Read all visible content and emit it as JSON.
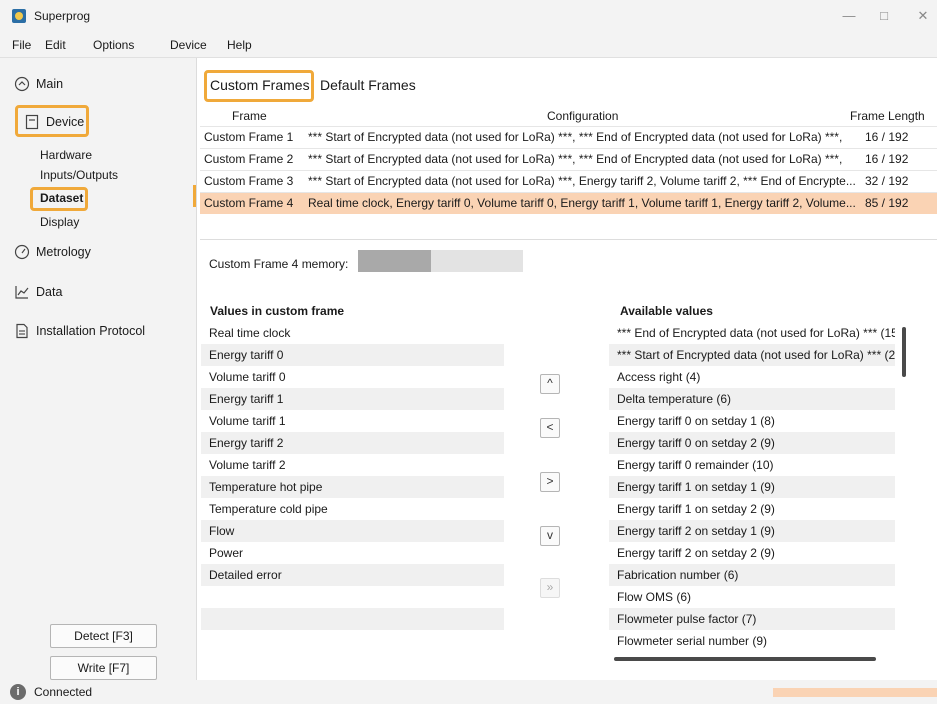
{
  "window": {
    "title": "Superprog",
    "minimize": "—",
    "maximize": "□",
    "close": "✕"
  },
  "menu": [
    "File",
    "Edit",
    "Options",
    "Device",
    "Help"
  ],
  "sidebar": {
    "main": "Main",
    "device": "Device",
    "device_items": [
      "Hardware",
      "Inputs/Outputs",
      "Dataset",
      "Display"
    ],
    "metrology": "Metrology",
    "data": "Data",
    "installation": "Installation Protocol",
    "detect_button": "Detect [F3]",
    "write_button": "Write [F7]"
  },
  "status": {
    "text": "Connected",
    "icon_glyph": "i"
  },
  "tabs": {
    "custom": "Custom Frames",
    "default": "Default Frames"
  },
  "frames_table": {
    "columns": [
      "Frame",
      "Configuration",
      "Frame Length"
    ],
    "rows": [
      {
        "frame": "Custom Frame 1",
        "config": "*** Start of Encrypted data (not used for LoRa) ***, *** End of Encrypted data (not used for LoRa) ***,",
        "length": "16 / 192"
      },
      {
        "frame": "Custom Frame 2",
        "config": "*** Start of Encrypted data (not used for LoRa) ***, *** End of Encrypted data (not used for LoRa) ***,",
        "length": "16 / 192"
      },
      {
        "frame": "Custom Frame 3",
        "config": "*** Start of Encrypted data (not used for LoRa) ***, Energy tariff 2, Volume tariff 2, *** End of Encrypte...",
        "length": "32 / 192"
      },
      {
        "frame": "Custom Frame 4",
        "config": "Real time clock, Energy tariff 0, Volume tariff 0, Energy tariff 1, Volume tariff 1, Energy tariff 2, Volume...",
        "length": "85 / 192"
      }
    ]
  },
  "memory": {
    "label": "Custom Frame 4 memory:",
    "fraction": 0.44
  },
  "values_list": {
    "title": "Values in custom frame",
    "items": [
      "Real time clock",
      "Energy tariff 0",
      "Volume tariff 0",
      "Energy tariff 1",
      "Volume tariff 1",
      "Energy tariff 2",
      "Volume tariff 2",
      "Temperature hot pipe",
      "Temperature cold pipe",
      "Flow",
      "Power",
      "Detailed error",
      "",
      "",
      ""
    ]
  },
  "available_list": {
    "title": "Available values",
    "items": [
      "*** End of Encrypted data (not used for LoRa) *** (15",
      "*** Start of Encrypted data (not used for LoRa) *** (2",
      "Access right (4)",
      "Delta temperature (6)",
      "Energy tariff 0 on setday 1 (8)",
      "Energy tariff 0 on setday 2 (9)",
      "Energy tariff 0 remainder (10)",
      "Energy tariff 1 on setday 1 (9)",
      "Energy tariff 1 on setday 2 (9)",
      "Energy tariff 2 on setday 1 (9)",
      "Energy tariff 2 on setday 2 (9)",
      "Fabrication number (6)",
      "Flow OMS (6)",
      "Flowmeter pulse factor (7)",
      "Flowmeter serial number (9)"
    ]
  },
  "move_buttons": {
    "up": "^",
    "left": "<",
    "right": ">",
    "down": "v",
    "all": "»"
  },
  "colors": {
    "highlight": "#f0a93a",
    "selected_row": "#fad3b4"
  }
}
